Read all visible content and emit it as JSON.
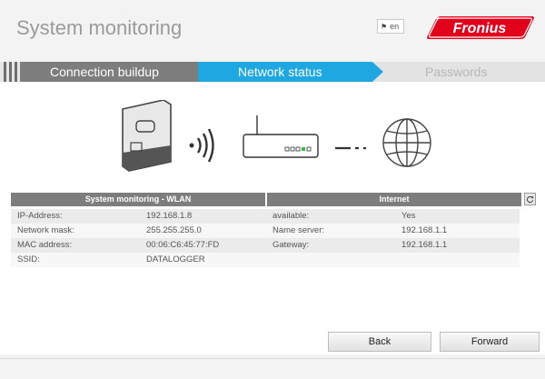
{
  "header": {
    "title": "System monitoring",
    "language": "en",
    "brand": "Fronius",
    "brand_color": "#e2001a"
  },
  "stepper": {
    "steps": [
      {
        "label": "Connection buildup",
        "state": "done"
      },
      {
        "label": "Network status",
        "state": "active"
      },
      {
        "label": "Passwords",
        "state": "pending"
      }
    ],
    "colors": {
      "done": "#7d7d7d",
      "active": "#1ea7e1",
      "pending": "#e3e3e3"
    }
  },
  "status_table": {
    "left": {
      "title": "System monitoring - WLAN",
      "rows": [
        {
          "label": "IP-Address:",
          "value": "192.168.1.8"
        },
        {
          "label": "Network mask:",
          "value": "255.255.255.0"
        },
        {
          "label": "MAC address:",
          "value": "00:06:C6:45:77:FD"
        },
        {
          "label": "SSID:",
          "value": "DATALOGGER"
        }
      ]
    },
    "right": {
      "title": "Internet",
      "rows": [
        {
          "label": "available:",
          "value": "Yes"
        },
        {
          "label": "Name server:",
          "value": "192.168.1.1"
        },
        {
          "label": "Gateway:",
          "value": "192.168.1.1"
        },
        {
          "label": "",
          "value": ""
        }
      ]
    },
    "refresh_icon": "refresh-icon"
  },
  "buttons": {
    "back": "Back",
    "forward": "Forward"
  }
}
